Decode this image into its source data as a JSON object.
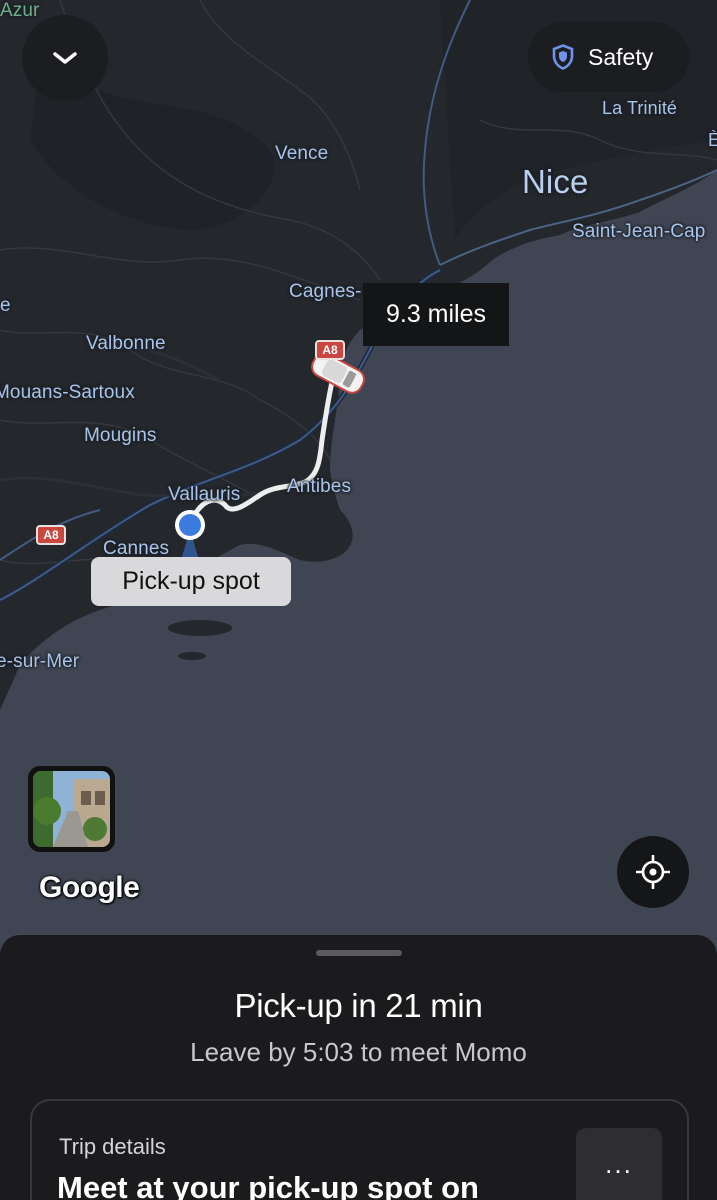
{
  "map": {
    "places": {
      "azur": "Azur",
      "vence": "Vence",
      "la_trinite": "La Trinité",
      "nice": "Nice",
      "saint_jean_cap": "Saint-Jean-Cap",
      "cagnes": "Cagnes-",
      "valbonne": "Valbonne",
      "mouans_sartoux": "Mouans-Sartoux",
      "mougins": "Mougins",
      "vallauris": "Vallauris",
      "antibes": "Antibes",
      "cannes": "Cannes",
      "sur_mer": "e-sur-Mer",
      "edge_e": "e",
      "edge_E": "È"
    },
    "route_shields": [
      "A8",
      "A8"
    ],
    "distance": "9.3 miles",
    "pickup_label": "Pick-up spot",
    "attribution": "Google"
  },
  "header": {
    "collapse_icon": "chevron-down-icon",
    "safety_label": "Safety",
    "safety_icon": "shield-icon"
  },
  "controls": {
    "locate_icon": "crosshair-icon"
  },
  "sheet": {
    "title": "Pick-up in 21 min",
    "subtitle": "Leave by 5:03 to meet Momo",
    "trip_card": {
      "label": "Trip details",
      "text": "Meet at your pick-up spot on",
      "more_label": "..."
    }
  },
  "colors": {
    "map_sea": "#3f4552",
    "map_land": "#24272c",
    "place_label": "#a9c4ea",
    "sheet_bg": "#1b1b1d",
    "pickup_dot": "#3b7be0"
  }
}
